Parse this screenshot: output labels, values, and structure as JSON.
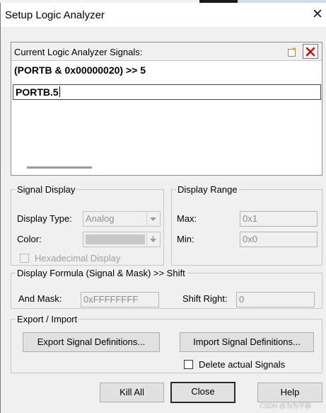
{
  "window": {
    "title": "Setup Logic Analyzer",
    "close_glyph": "✕"
  },
  "signals": {
    "header_label": "Current Logic Analyzer Signals:",
    "rows": [
      "(PORTB & 0x00000020) >> 5",
      "PORTB.5"
    ]
  },
  "signal_display": {
    "legend": "Signal Display",
    "display_type_label": "Display Type:",
    "display_type_value": "Analog",
    "color_label": "Color:",
    "hex_label": "Hexadecimal Display"
  },
  "display_range": {
    "legend": "Display Range",
    "max_label": "Max:",
    "max_value": "0x1",
    "min_label": "Min:",
    "min_value": "0x0"
  },
  "formula": {
    "legend": "Display Formula (Signal & Mask) >> Shift",
    "and_mask_label": "And Mask:",
    "and_mask_value": "0xFFFFFFFF",
    "shift_label": "Shift Right:",
    "shift_value": "0"
  },
  "export_import": {
    "legend": "Export / Import",
    "export_button": "Export Signal Definitions...",
    "import_button": "Import Signal Definitions...",
    "delete_label": "Delete actual Signals"
  },
  "buttons": {
    "kill_all": "Kill All",
    "close": "Close",
    "help": "Help"
  },
  "watermark": "CSDN @为为不恭",
  "colors": {
    "titlebar": "#ffffff",
    "dialog": "#f0f0f0",
    "delete_icon": "#cc1111"
  }
}
